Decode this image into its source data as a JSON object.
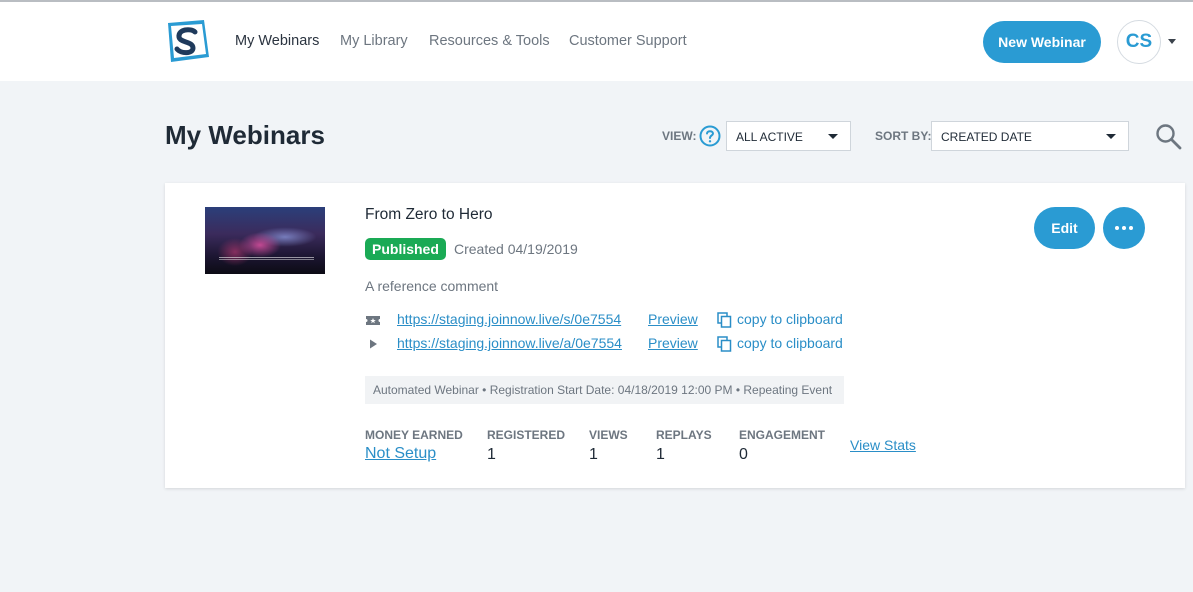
{
  "nav": {
    "items": [
      {
        "label": "My Webinars",
        "active": true
      },
      {
        "label": "My Library",
        "active": false
      },
      {
        "label": "Resources & Tools",
        "active": false
      },
      {
        "label": "Customer Support",
        "active": false
      }
    ],
    "new_button": "New Webinar",
    "avatar_initials": "CS"
  },
  "page": {
    "title": "My Webinars",
    "view_label": "VIEW:",
    "view_value": "ALL ACTIVE",
    "sort_label": "SORT BY:",
    "sort_value": "CREATED DATE"
  },
  "webinar": {
    "title": "From Zero to Hero",
    "status": "Published",
    "created": "Created 04/19/2019",
    "comment": "A reference comment",
    "links": [
      {
        "icon": "ticket-icon",
        "url": "https://staging.joinnow.live/s/0e7554",
        "preview": "Preview",
        "copy": "copy to clipboard"
      },
      {
        "icon": "play-icon",
        "url": "https://staging.joinnow.live/a/0e7554",
        "preview": "Preview",
        "copy": "copy to clipboard"
      }
    ],
    "info": "Automated Webinar • Registration Start Date: 04/18/2019 12:00 PM • Repeating Event",
    "stats": [
      {
        "label": "MONEY EARNED",
        "value": "Not Setup"
      },
      {
        "label": "REGISTERED",
        "value": "1"
      },
      {
        "label": "VIEWS",
        "value": "1"
      },
      {
        "label": "REPLAYS",
        "value": "1"
      },
      {
        "label": "ENGAGEMENT",
        "value": "0"
      }
    ],
    "view_stats": "View Stats",
    "edit_button": "Edit"
  },
  "colors": {
    "accent": "#2a9bd3",
    "published": "#1aaa55",
    "background": "#f1f4f7"
  }
}
